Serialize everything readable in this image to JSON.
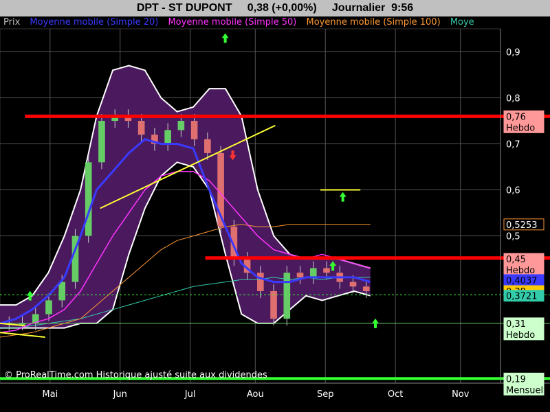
{
  "header": {
    "symbol": "DPT - ST DUPONT",
    "price": "0,38 (+0,00%)",
    "period": "Journalier",
    "time": "9:56"
  },
  "legend": [
    {
      "label": "Prix",
      "color": "#c0c0c0"
    },
    {
      "label": "Moyenne mobile (Simple 20)",
      "color": "#3a3aff"
    },
    {
      "label": "Moyenne mobile (Simple 50)",
      "color": "#ff33ff"
    },
    {
      "label": "Moyenne mobile (Simple 100)",
      "color": "#ff9933"
    },
    {
      "label": "Moye",
      "color": "#33ccaa"
    }
  ],
  "copyright": "© ProRealTime.com Historique ajusté suite aux dividendes",
  "chart_data": {
    "type": "candlestick",
    "x_ticks": [
      "Mai",
      "Jun",
      "Jul",
      "Aou",
      "Sep",
      "Oct",
      "Nov"
    ],
    "y_ticks": [
      "0,9",
      "0,8",
      "0,7",
      "0,6",
      "0,5"
    ],
    "ylim": [
      0.18,
      0.95
    ],
    "level_labels": [
      {
        "value": 0.76,
        "text": "0,76",
        "sub": "Hebdo",
        "bg": "#ff9999",
        "fg": "#000"
      },
      {
        "value": 0.525,
        "text": "0,5253",
        "sub": "",
        "bg": "#000000",
        "fg": "#ffffff",
        "border": "#ff9933"
      },
      {
        "value": 0.45,
        "text": "0,45",
        "sub": "Hebdo",
        "bg": "#ff9999",
        "fg": "#000"
      },
      {
        "value": 0.404,
        "text": "0,4037",
        "sub": "",
        "bg": "#3a3aff",
        "fg": "#000"
      },
      {
        "value": 0.38,
        "text": "0,38",
        "sub": "",
        "bg": "#ffcc00",
        "fg": "#000"
      },
      {
        "value": 0.37,
        "text": "0,3721",
        "sub": "",
        "bg": "#33ccaa",
        "fg": "#000"
      },
      {
        "value": 0.31,
        "text": "0,31",
        "sub": "Hebdo",
        "bg": "#ccffcc",
        "fg": "#000"
      },
      {
        "value": 0.19,
        "text": "0,19",
        "sub": "Mensuel",
        "bg": "#ccffcc",
        "fg": "#000"
      }
    ],
    "support_resistance": [
      {
        "value": 0.76,
        "x0": 0.05,
        "x1": 1.0,
        "color": "#ff0000",
        "width": 5
      },
      {
        "value": 0.452,
        "x0": 0.41,
        "x1": 1.0,
        "color": "#ff0000",
        "width": 5
      },
      {
        "value": 0.31,
        "x0": 0.0,
        "x1": 1.0,
        "color": "#66cc66",
        "width": 1
      },
      {
        "value": 0.19,
        "x0": 0.0,
        "x1": 1.0,
        "color": "#33ff33",
        "width": 4
      },
      {
        "value": 0.372,
        "x0": 0.0,
        "x1": 1.0,
        "color": "#33ff33",
        "width": 1,
        "dash": true
      }
    ],
    "trendlines": [
      {
        "x0": 0.2,
        "y0": 0.56,
        "x1": 0.55,
        "y1": 0.74,
        "color": "#ffff33"
      },
      {
        "x0": 0.64,
        "y0": 0.6,
        "x1": 0.72,
        "y1": 0.6,
        "color": "#ffff33"
      },
      {
        "x0": 0.0,
        "y0": 0.29,
        "x1": 0.09,
        "y1": 0.28,
        "color": "#ffff33"
      },
      {
        "x0": 0.0,
        "y0": 0.31,
        "x1": 0.05,
        "y1": 0.305,
        "color": "#ffff33"
      }
    ],
    "arrows": [
      {
        "x": 0.06,
        "y": 0.37,
        "dir": "up",
        "color": "#33ff33"
      },
      {
        "x": 0.45,
        "y": 0.93,
        "dir": "up",
        "color": "#33ff33"
      },
      {
        "x": 0.465,
        "y": 0.675,
        "dir": "down",
        "color": "#ff3333"
      },
      {
        "x": 0.685,
        "y": 0.585,
        "dir": "up",
        "color": "#33ff33"
      },
      {
        "x": 0.665,
        "y": 0.435,
        "dir": "up",
        "color": "#33ff33"
      },
      {
        "x": 0.75,
        "y": 0.31,
        "dir": "up",
        "color": "#33ff33"
      }
    ],
    "bands": {
      "upper": [
        0.35,
        0.35,
        0.37,
        0.42,
        0.5,
        0.6,
        0.76,
        0.86,
        0.87,
        0.86,
        0.8,
        0.77,
        0.78,
        0.82,
        0.82,
        0.76,
        0.6,
        0.5,
        0.46,
        0.45,
        0.45,
        0.45,
        0.44,
        0.43
      ],
      "lower": [
        0.3,
        0.3,
        0.3,
        0.3,
        0.3,
        0.31,
        0.31,
        0.34,
        0.46,
        0.56,
        0.63,
        0.66,
        0.65,
        0.6,
        0.46,
        0.33,
        0.31,
        0.31,
        0.34,
        0.37,
        0.36,
        0.37,
        0.38,
        0.37
      ]
    },
    "ma20": [
      0.31,
      0.32,
      0.34,
      0.37,
      0.41,
      0.5,
      0.6,
      0.64,
      0.68,
      0.71,
      0.7,
      0.7,
      0.69,
      0.6,
      0.52,
      0.44,
      0.41,
      0.4,
      0.4,
      0.41,
      0.41,
      0.41,
      0.41,
      0.4
    ],
    "ma50": [
      0.29,
      0.295,
      0.31,
      0.32,
      0.34,
      0.38,
      0.44,
      0.5,
      0.55,
      0.6,
      0.63,
      0.64,
      0.64,
      0.62,
      0.58,
      0.54,
      0.5,
      0.47,
      0.46,
      0.45,
      0.46,
      0.45,
      0.44,
      0.43
    ],
    "ma100": [
      0.28,
      0.285,
      0.29,
      0.3,
      0.31,
      0.32,
      0.35,
      0.38,
      0.41,
      0.44,
      0.47,
      0.49,
      0.5,
      0.51,
      0.52,
      0.525,
      0.52,
      0.52,
      0.525,
      0.525,
      0.525,
      0.525,
      0.525,
      0.525
    ],
    "ma_extra": [
      0.3,
      0.3,
      0.305,
      0.31,
      0.315,
      0.32,
      0.33,
      0.34,
      0.35,
      0.36,
      0.37,
      0.38,
      0.39,
      0.395,
      0.4,
      0.405,
      0.405,
      0.41,
      0.405,
      0.41,
      0.405,
      0.41,
      0.41,
      0.41
    ],
    "closes": [
      0.31,
      0.31,
      0.33,
      0.36,
      0.4,
      0.5,
      0.66,
      0.75,
      0.76,
      0.75,
      0.72,
      0.7,
      0.73,
      0.75,
      0.71,
      0.68,
      0.52,
      0.45,
      0.42,
      0.38,
      0.32,
      0.42,
      0.41,
      0.43,
      0.42,
      0.4,
      0.39,
      0.38
    ]
  }
}
